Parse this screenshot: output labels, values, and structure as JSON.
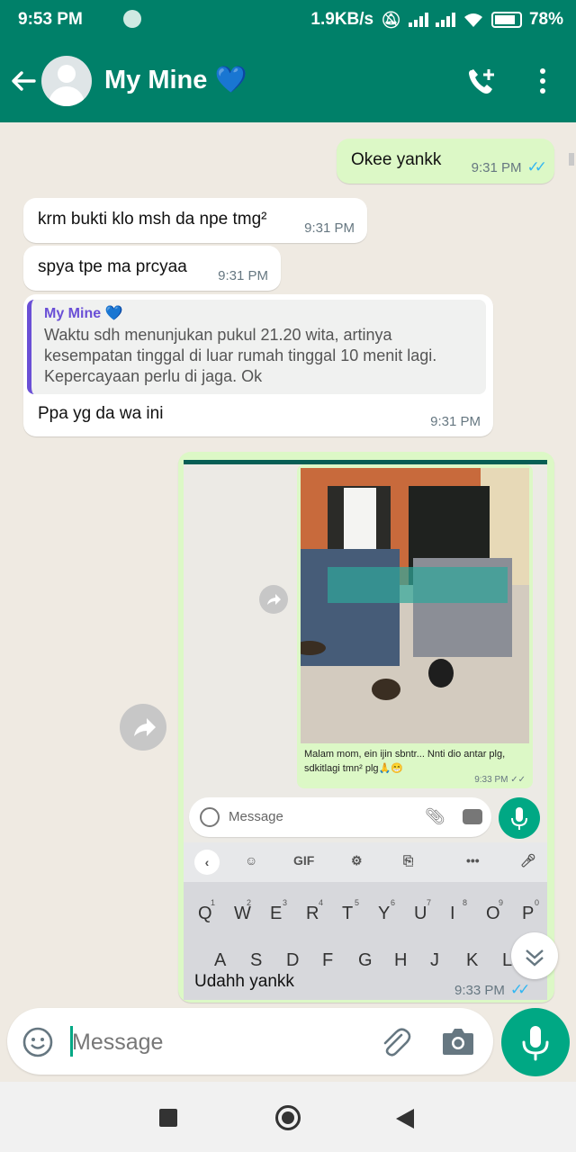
{
  "status_bar": {
    "time": "9:53 PM",
    "network_speed": "1.9KB/s",
    "battery": "78%"
  },
  "header": {
    "contact_name": "My Mine 💙",
    "icons": [
      "back-arrow-icon",
      "avatar-icon",
      "add-call-icon",
      "more-vert-icon"
    ]
  },
  "messages": [
    {
      "direction": "out",
      "text": "Okee yankk",
      "time": "9:31 PM",
      "status": "read"
    },
    {
      "direction": "in",
      "text": "krm bukti klo msh da npe tmg²",
      "time": "9:31 PM"
    },
    {
      "direction": "in",
      "text": "spya tpe ma prcyaa",
      "time": "9:31 PM"
    },
    {
      "direction": "in",
      "quote_name": "My Mine 💙",
      "quote_text": "Waktu sdh menunjukan pukul 21.20 wita, artinya kesempatan tinggal di luar rumah tinggal 10 menit lagi. Kepercayaan perlu di jaga. Ok",
      "text": "Ppa yg da wa ini",
      "time": "9:31 PM"
    },
    {
      "direction": "out",
      "type": "screenshot",
      "text": "Udahh yankk",
      "time": "9:33 PM",
      "status": "read"
    }
  ],
  "embedded_screenshot": {
    "caption": "Malam mom, ein ijin sbntr... Nnti dio antar plg, sdkitlagi tmn² plg🙏😁",
    "caption_time": "9:33 PM",
    "input_placeholder": "Message",
    "keyboard_toolbar": [
      "GIF"
    ],
    "keyboard_row1": [
      "Q",
      "W",
      "E",
      "R",
      "T",
      "Y",
      "U",
      "I",
      "O",
      "P"
    ],
    "keyboard_row1_numbers": [
      "1",
      "2",
      "3",
      "4",
      "5",
      "6",
      "7",
      "8",
      "9",
      "0"
    ],
    "keyboard_row2": [
      "A",
      "S",
      "D",
      "F",
      "G",
      "H",
      "J",
      "K",
      "L"
    ]
  },
  "input": {
    "placeholder": "Message"
  },
  "colors": {
    "header": "#008069",
    "incoming_bubble": "#ffffff",
    "outgoing_bubble": "#dcf8c6",
    "read_ticks": "#34b7f1",
    "mic_button": "#00a884",
    "quote_accent": "#6a4fd6"
  }
}
